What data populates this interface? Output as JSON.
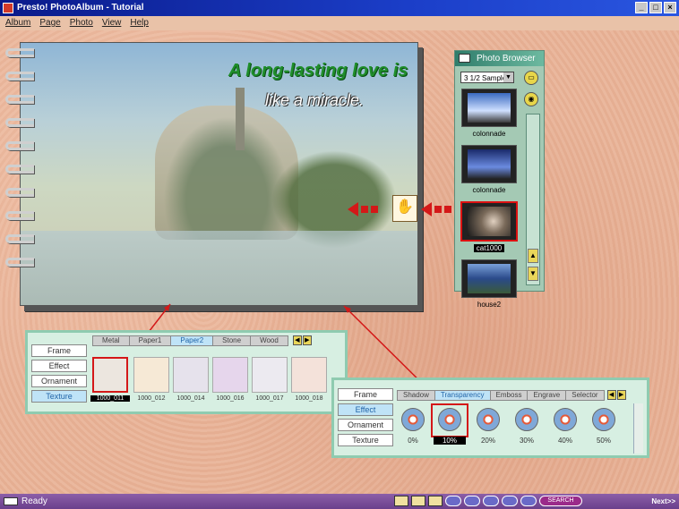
{
  "window": {
    "title": "Presto! PhotoAlbum - Tutorial"
  },
  "menu": [
    "Album",
    "Page",
    "Photo",
    "View",
    "Help"
  ],
  "album": {
    "line1": "A long-lasting love is",
    "line2": "like a miracle."
  },
  "photo_browser": {
    "title": "Photo Browser",
    "folder": "3 1/2 Sample",
    "items": [
      {
        "label": "colonnade",
        "selected": false
      },
      {
        "label": "colonnade",
        "selected": false
      },
      {
        "label": "cat1000",
        "selected": true
      },
      {
        "label": "house2",
        "selected": false
      }
    ]
  },
  "texture_panel": {
    "side_buttons": [
      "Frame",
      "Effect",
      "Ornament",
      "Texture"
    ],
    "active_side": "Texture",
    "tabs": [
      "Metal",
      "Paper1",
      "Paper2",
      "Stone",
      "Wood"
    ],
    "active_tab": "Paper2",
    "swatches": [
      {
        "label": "1000_011",
        "color": "#ece6df",
        "selected": true
      },
      {
        "label": "1000_012",
        "color": "#f6e9d6",
        "selected": false
      },
      {
        "label": "1000_014",
        "color": "#e6e2ec",
        "selected": false
      },
      {
        "label": "1000_016",
        "color": "#e6d6ec",
        "selected": false
      },
      {
        "label": "1000_017",
        "color": "#eceaf0",
        "selected": false
      },
      {
        "label": "1000_018",
        "color": "#f4e2da",
        "selected": false
      }
    ]
  },
  "effect_panel": {
    "side_buttons": [
      "Frame",
      "Effect",
      "Ornament",
      "Texture"
    ],
    "active_side": "Effect",
    "tabs": [
      "Shadow",
      "Transparency",
      "Emboss",
      "Engrave",
      "Selector"
    ],
    "active_tab": "Transparency",
    "items": [
      {
        "label": "0%",
        "selected": false
      },
      {
        "label": "10%",
        "selected": true
      },
      {
        "label": "20%",
        "selected": false
      },
      {
        "label": "30%",
        "selected": false
      },
      {
        "label": "40%",
        "selected": false
      },
      {
        "label": "50%",
        "selected": false
      }
    ]
  },
  "status": {
    "text": "Ready",
    "search": "SEARCH",
    "next": "Next>>"
  }
}
